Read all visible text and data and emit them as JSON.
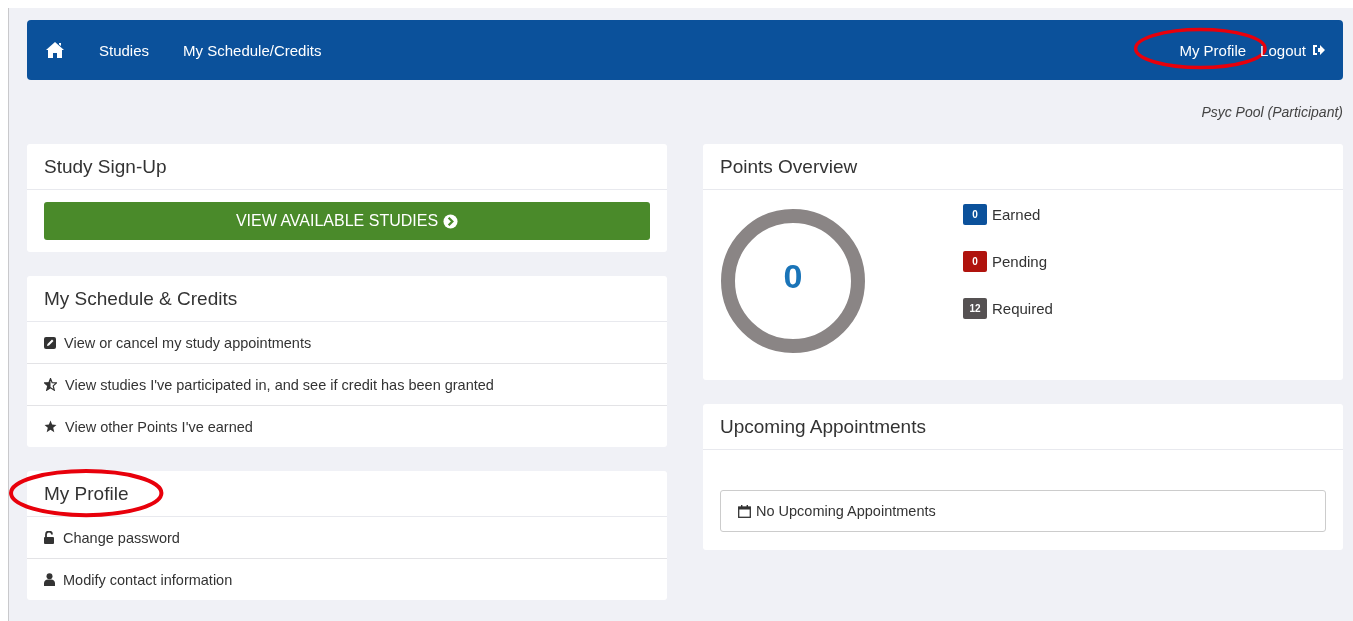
{
  "nav": {
    "left": [
      {
        "label": "Studies"
      },
      {
        "label": "My Schedule/Credits"
      }
    ],
    "right": [
      {
        "label": "My Profile",
        "highlighted": true
      },
      {
        "label": "Logout",
        "highlighted": false
      }
    ]
  },
  "role": "Psyc Pool (Participant)",
  "signup": {
    "title": "Study Sign-Up",
    "button": "VIEW AVAILABLE STUDIES"
  },
  "schedule": {
    "title": "My Schedule & Credits",
    "items": [
      {
        "kind": "edit",
        "label": "View or cancel my study appointments"
      },
      {
        "kind": "half-star",
        "label": "View studies I've participated in, and see if credit has been granted"
      },
      {
        "kind": "star",
        "label": "View other Points I've earned"
      }
    ]
  },
  "profile": {
    "title": "My Profile",
    "highlighted": true,
    "items": [
      {
        "kind": "unlock",
        "label": "Change password"
      },
      {
        "kind": "user",
        "label": "Modify contact information"
      }
    ]
  },
  "points": {
    "title": "Points Overview",
    "total": "0",
    "legend": [
      {
        "count": "0",
        "label": "Earned",
        "color": "#0b519b"
      },
      {
        "count": "0",
        "label": "Pending",
        "color": "#b0130d"
      },
      {
        "count": "12",
        "label": "Required",
        "color": "#555152"
      }
    ]
  },
  "upcoming": {
    "title": "Upcoming Appointments",
    "empty": "No Upcoming Appointments"
  }
}
